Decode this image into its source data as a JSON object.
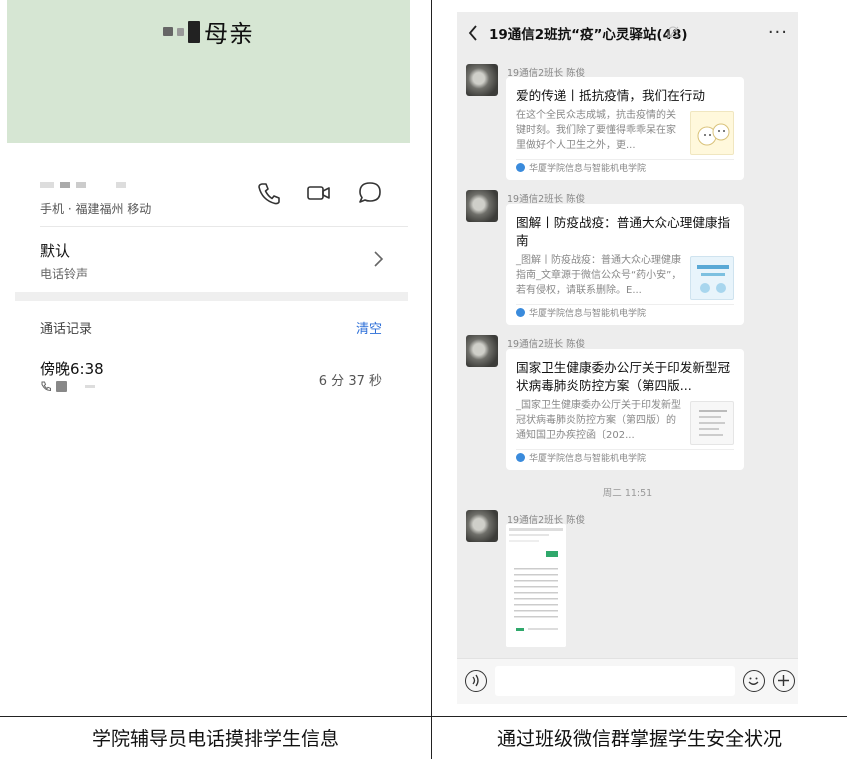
{
  "left_panel": {
    "contact_name": "母亲",
    "phone_meta": "手机 · 福建福州 移动",
    "ringtone_title": "默认",
    "ringtone_sub": "电话铃声",
    "call_log_title": "通话记录",
    "clear_label": "清空",
    "call_time": "傍晚6:38",
    "call_duration": "6 分 37 秒"
  },
  "right_panel": {
    "chat_title": "19通信2班抗“疫”心灵驿站(48)",
    "more_label": "···",
    "messages": [
      {
        "sender": "19通信2班长 陈俊",
        "title": "爱的传递丨抵抗疫情，我们在行动",
        "desc": "在这个全民众志成城，抗击疫情的关键时刻。我们除了要懂得乖乖呆在家里做好个人卫生之外，更...",
        "source": "华厦学院信息与智能机电学院"
      },
      {
        "sender": "19通信2班长 陈俊",
        "title": "图解丨防疫战疫：普通大众心理健康指南",
        "desc": "_图解丨防疫战疫：普通大众心理健康指南_文章源于微信公众号“药小安”，若有侵权，请联系删除。E...",
        "source": "华厦学院信息与智能机电学院"
      },
      {
        "sender": "19通信2班长 陈俊",
        "title": "国家卫生健康委办公厅关于印发新型冠状病毒肺炎防控方案（第四版...",
        "desc": "_国家卫生健康委办公厅关于印发新型冠状病毒肺炎防控方案（第四版）的通知国卫办疾控函〔202...",
        "source": "华厦学院信息与智能机电学院"
      },
      {
        "sender": "19通信2班长 陈俊"
      }
    ],
    "timestamp": "周二 11:51"
  },
  "captions": {
    "left": "学院辅导员电话摸排学生信息",
    "right": "通过班级微信群掌握学生安全状况"
  },
  "colors": {
    "header_green": "#d6e6d3",
    "link_blue": "#2d6fd8",
    "chat_bg": "#ededed"
  }
}
